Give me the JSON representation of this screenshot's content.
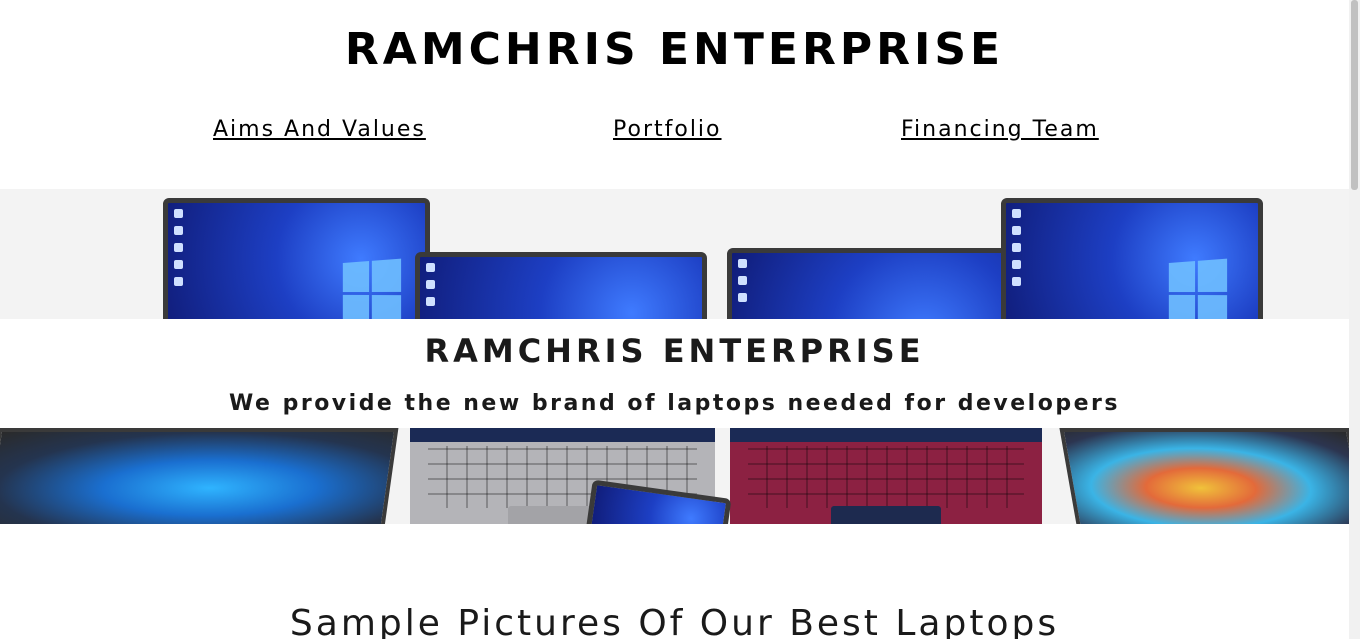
{
  "header": {
    "title": "RAMCHRIS ENTERPRISE"
  },
  "nav": {
    "items": [
      {
        "label": "Aims And Values"
      },
      {
        "label": "Portfolio"
      },
      {
        "label": "Financing Team"
      }
    ]
  },
  "hero": {
    "title": "RAMCHRIS ENTERPRISE",
    "subtitle": "We provide the new brand of laptops needed for developers",
    "image_subject": "laptops-collage",
    "colors": {
      "screen_blue": "#1d3fc4",
      "background": "#f3f3f3",
      "band": "#ffffff"
    }
  },
  "section": {
    "heading": "Sample Pictures Of Our Best Laptops"
  }
}
